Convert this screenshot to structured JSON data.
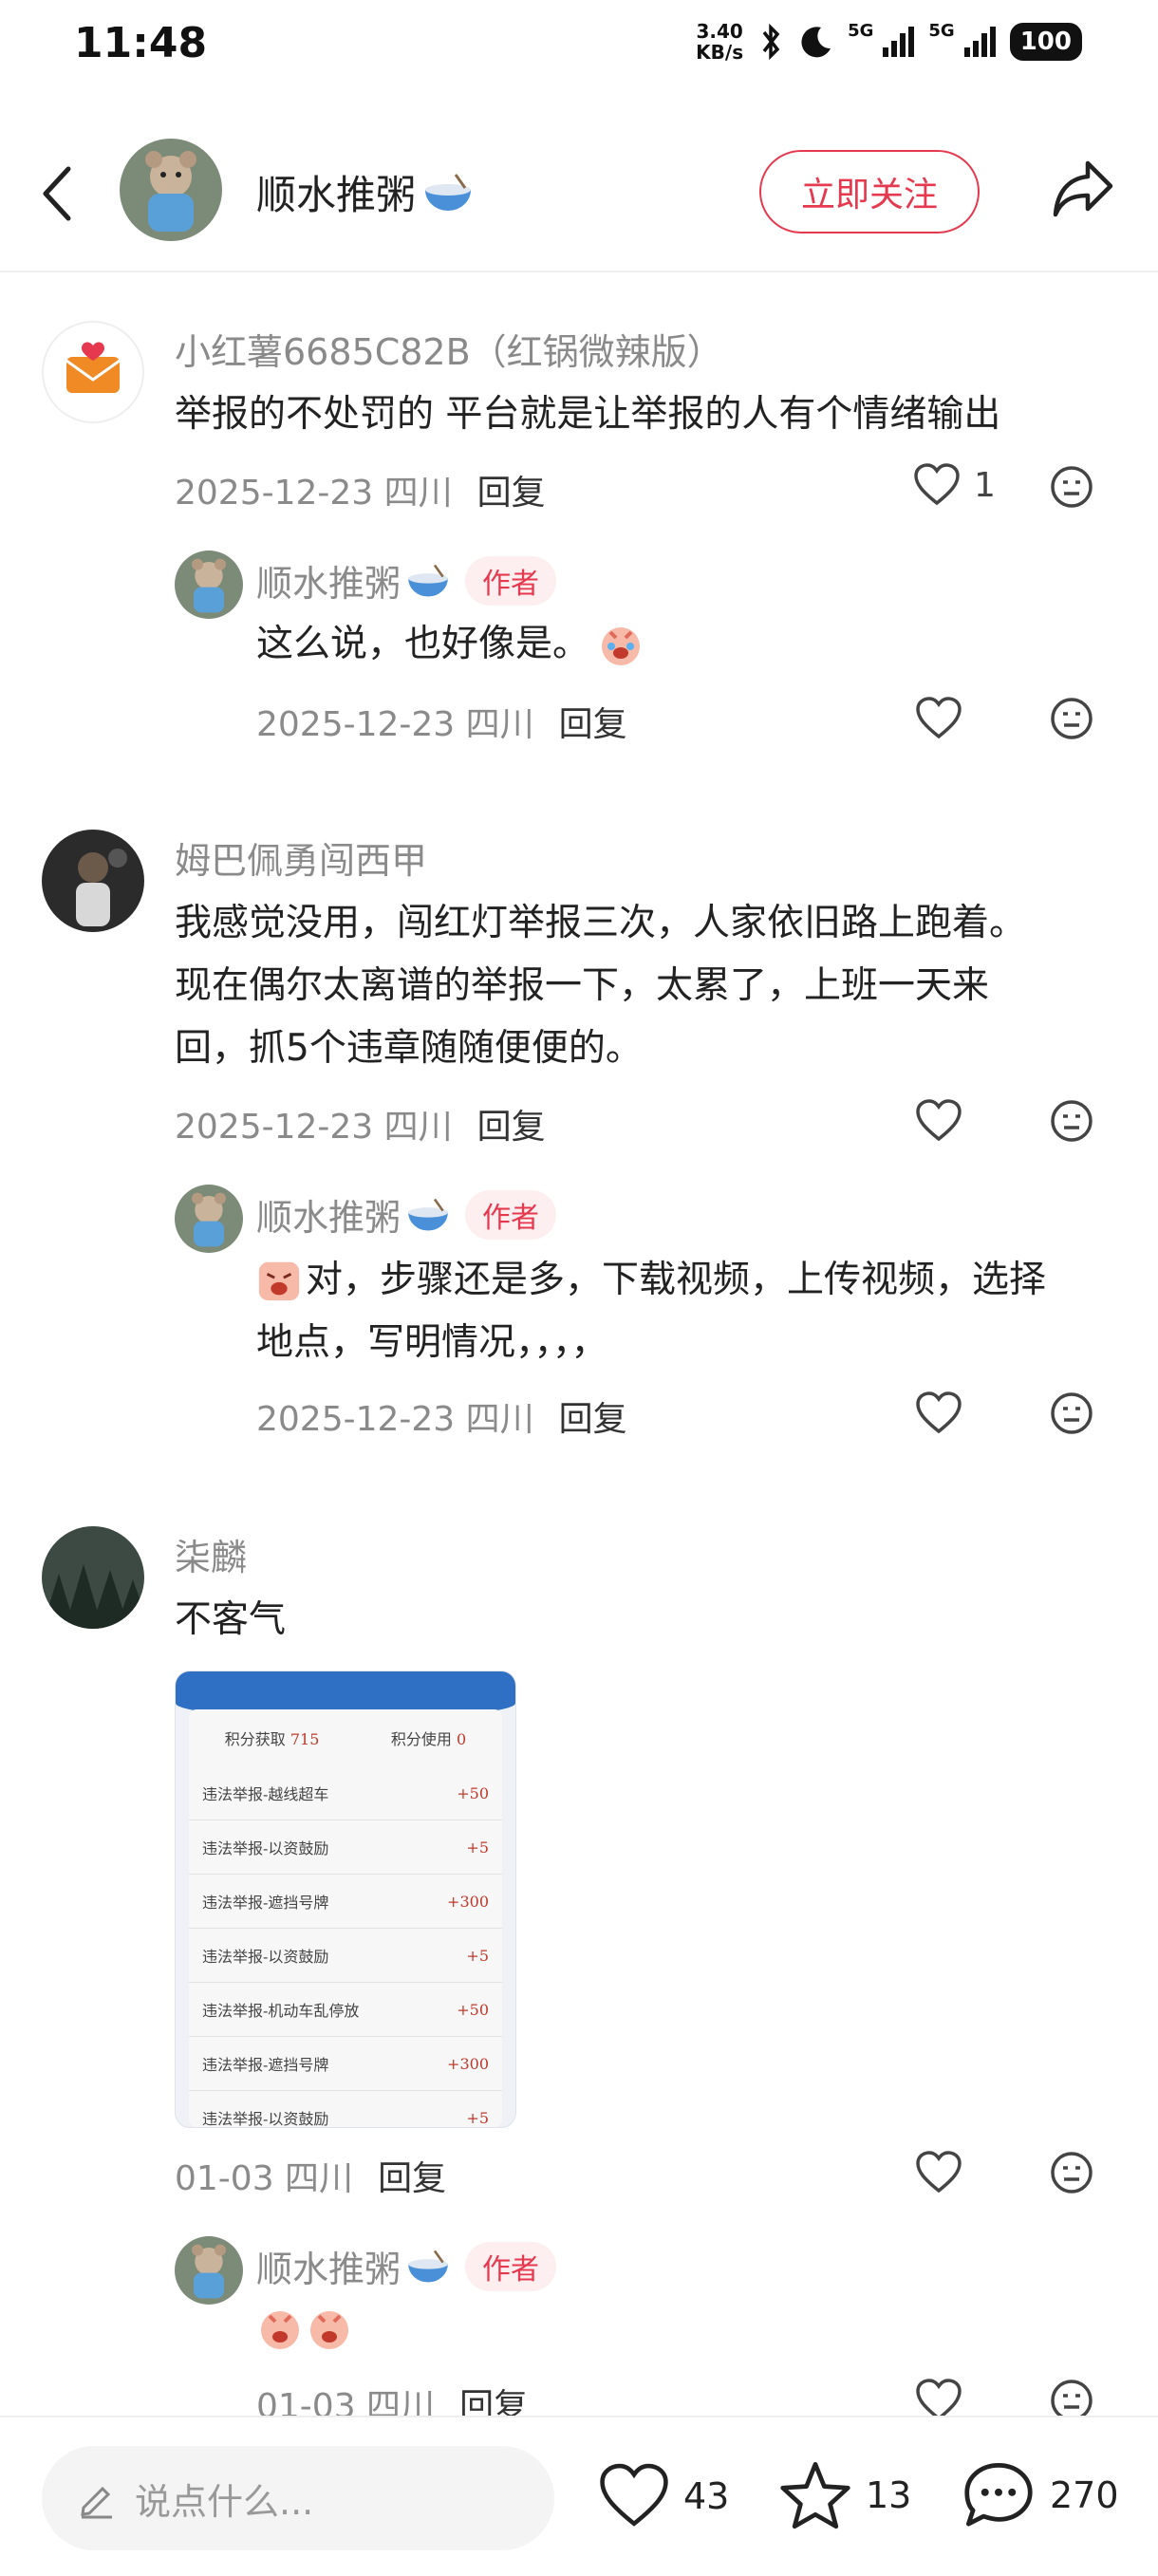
{
  "status_bar": {
    "time": "11:48",
    "net_speed_value": "3.40",
    "net_speed_unit": "KB/s",
    "sim1_label": "5G",
    "sim2_label": "5G",
    "battery": "100"
  },
  "header": {
    "name": "顺水推粥",
    "follow_label": "立即关注"
  },
  "comments": [
    {
      "user": "小红薯6685C82B（红锅微辣版）",
      "text": "举报的不处罚的 平台就是让举报的人有个情绪输出",
      "date": "2025-12-23 四川",
      "reply": "回复",
      "likes": "1",
      "sub": {
        "user": "顺水推粥",
        "badge": "作者",
        "text": "这么说，也好像是。",
        "date": "2025-12-23 四川",
        "reply": "回复"
      }
    },
    {
      "user": "姆巴佩勇闯西甲",
      "lines": [
        "我感觉没用，闯红灯举报三次，人家依旧路上跑着。",
        "现在偶尔太离谱的举报一下，太累了，上班一天来",
        "回，抓5个违章随随便便的。"
      ],
      "date": "2025-12-23 四川",
      "reply": "回复",
      "sub": {
        "user": "顺水推粥",
        "badge": "作者",
        "lines": [
          "对，步骤还是多，下载视频，上传视频，选择",
          "地点，写明情况，，，，"
        ],
        "date": "2025-12-23 四川",
        "reply": "回复"
      }
    },
    {
      "user": "柒麟",
      "text": "不客气",
      "date": "01-03 四川",
      "reply": "回复",
      "attachment": {
        "earned_label": "积分获取",
        "earned_value": "715",
        "used_label": "积分使用",
        "used_value": "0",
        "rows": [
          {
            "label": "违法举报-越线超车",
            "points": "+50"
          },
          {
            "label": "违法举报-以资鼓励",
            "points": "+5"
          },
          {
            "label": "违法举报-遮挡号牌",
            "points": "+300"
          },
          {
            "label": "违法举报-以资鼓励",
            "points": "+5"
          },
          {
            "label": "违法举报-机动车乱停放",
            "points": "+50"
          },
          {
            "label": "违法举报-遮挡号牌",
            "points": "+300"
          },
          {
            "label": "违法举报-以资鼓励",
            "points": "+5"
          }
        ]
      },
      "sub": {
        "user": "顺水推粥",
        "badge": "作者",
        "date": "01-03 四川",
        "reply": "回复"
      }
    }
  ],
  "bottom_bar": {
    "placeholder": "说点什么...",
    "likes": "43",
    "stars": "13",
    "comments": "270"
  },
  "colors": {
    "accent": "#e5394f",
    "meta_gray": "#8a8a8a"
  }
}
